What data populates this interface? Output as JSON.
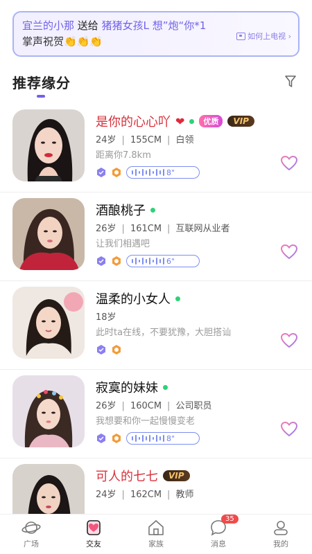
{
  "banner": {
    "sender": "宜兰的小那",
    "action": "送给",
    "receiver": "猪猪女孩L",
    "gift": "想”炮“你*1",
    "message": "掌声祝贺👏👏👏",
    "tv_link": "如何上电视 ›"
  },
  "section_title": "推荐缘分",
  "icons": {
    "filter": "filter-icon",
    "like": "heart-outline-icon",
    "verify": "hexagon-check-icon",
    "voice": "voice-wave-icon"
  },
  "colors": {
    "accent": "#6f62e8",
    "online": "#2fd178",
    "highlight_name": "#d8323c",
    "badge_red": "#f04b4b"
  },
  "profiles": [
    {
      "name": "是你的心心吖",
      "name_emoji": "❤",
      "red": true,
      "badge_quality": "优质",
      "badge_vip": "VIP",
      "age": "24岁",
      "height": "155CM",
      "job": "白领",
      "desc": "距离你7.8km",
      "voice": "8\""
    },
    {
      "name": "酒酿桃子",
      "red": false,
      "age": "26岁",
      "height": "161CM",
      "job": "互联网从业者",
      "desc": "让我们相遇吧",
      "voice": "6\""
    },
    {
      "name": "温柔的小女人",
      "red": false,
      "age": "18岁",
      "desc": "此时ta在线，不要犹豫，大胆搭讪"
    },
    {
      "name": "寂寞的妹妹",
      "red": false,
      "age": "26岁",
      "height": "160CM",
      "job": "公司职员",
      "desc": "我想要和你一起慢慢变老",
      "voice": "8\""
    },
    {
      "name": "可人的七七",
      "red": true,
      "badge_vip": "VIP",
      "age": "24岁",
      "height": "162CM",
      "job": "教师"
    }
  ],
  "tabs": [
    {
      "label": "广场",
      "icon": "planet-icon"
    },
    {
      "label": "交友",
      "icon": "heart-cards-icon",
      "active": true
    },
    {
      "label": "家族",
      "icon": "house-icon"
    },
    {
      "label": "消息",
      "icon": "chat-bubble-icon",
      "badge": "35"
    },
    {
      "label": "我的",
      "icon": "person-icon"
    }
  ]
}
